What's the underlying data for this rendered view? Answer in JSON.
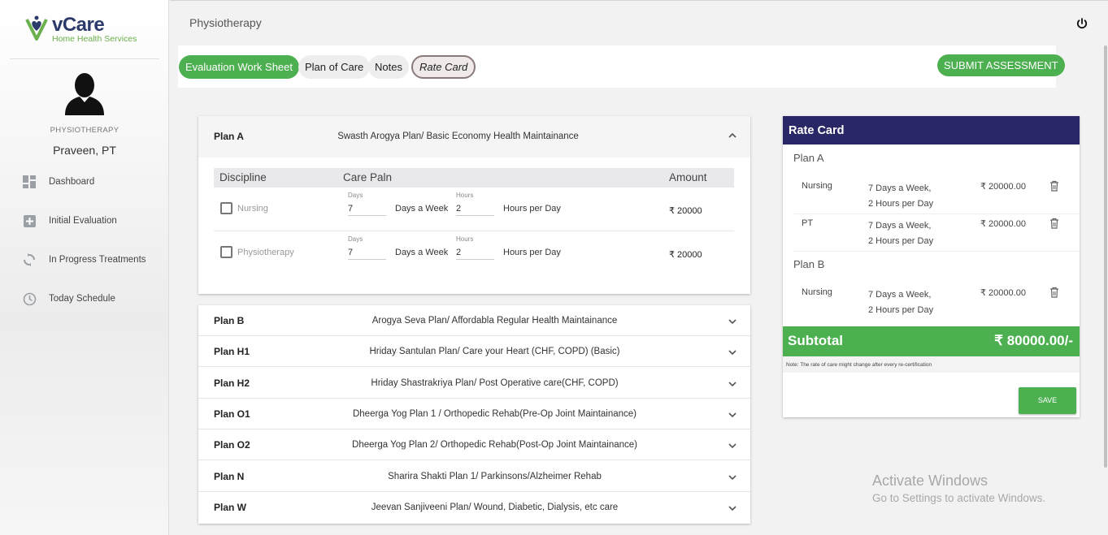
{
  "brand": {
    "name": "vCare",
    "tagline": "Home Health Services"
  },
  "user": {
    "role": "PHYSIOTHERAPY",
    "name": "Praveen, PT"
  },
  "nav": {
    "items": [
      {
        "label": "Dashboard",
        "icon": "dashboard-icon"
      },
      {
        "label": "Initial Evaluation",
        "icon": "plus-box-icon"
      },
      {
        "label": "In Progress Treatments",
        "icon": "sync-icon"
      },
      {
        "label": "Today Schedule",
        "icon": "clock-icon"
      }
    ]
  },
  "header": {
    "title": "Physiotherapy",
    "power_icon": "power-icon"
  },
  "tabs": [
    {
      "label": "Evaluation Work Sheet",
      "state": "active"
    },
    {
      "label": "Plan of Care",
      "state": "default"
    },
    {
      "label": "Notes",
      "state": "default"
    },
    {
      "label": "Rate Card",
      "state": "selected"
    }
  ],
  "submit_label": "SUBMIT ASSESSMENT",
  "planA": {
    "code": "Plan A",
    "desc": "Swasth Arogya Plan/ Basic Economy Health Maintainance",
    "columns": {
      "discipline": "Discipline",
      "care_plan": "Care Paln",
      "amount": "Amount"
    },
    "rows": [
      {
        "discipline": "Nursing",
        "days_label": "Days",
        "days": "7",
        "days_text": "Days a Week",
        "hours_label": "Hours",
        "hours": "2",
        "hours_text": "Hours per Day",
        "amount": "₹ 20000"
      },
      {
        "discipline": "Physiotherapy",
        "days_label": "Days",
        "days": "7",
        "days_text": "Days a Week",
        "hours_label": "Hours",
        "hours": "2",
        "hours_text": "Hours per Day",
        "amount": "₹ 20000"
      }
    ]
  },
  "plans": [
    {
      "code": "Plan B",
      "desc": "Arogya Seva Plan/ Affordabla Regular Health Maintainance"
    },
    {
      "code": "Plan H1",
      "desc": "Hriday Santulan Plan/ Care your Heart (CHF, COPD) (Basic)"
    },
    {
      "code": "Plan H2",
      "desc": "Hriday Shastrakriya Plan/ Post Operative care(CHF, COPD)"
    },
    {
      "code": "Plan O1",
      "desc": "Dheerga Yog Plan 1 / Orthopedic Rehab(Pre-Op Joint Maintainance)"
    },
    {
      "code": "Plan O2",
      "desc": "Dheerga Yog Plan 2/ Orthopedic Rehab(Post-Op Joint Maintainance)"
    },
    {
      "code": "Plan N",
      "desc": "Sharira Shakti Plan 1/ Parkinsons/Alzheimer Rehab"
    },
    {
      "code": "Plan W",
      "desc": "Jeevan Sanjiveeni Plan/ Wound, Diabetic, Dialysis, etc care"
    }
  ],
  "rate_card": {
    "title": "Rate Card",
    "groups": [
      {
        "plan": "Plan A",
        "items": [
          {
            "service": "Nursing",
            "sched1": "7 Days a Week,",
            "sched2": "2 Hours per Day",
            "price": "₹ 20000.00"
          },
          {
            "service": "PT",
            "sched1": "7 Days a Week,",
            "sched2": "2 Hours per Day",
            "price": "₹ 20000.00"
          }
        ]
      },
      {
        "plan": "Plan B",
        "items": [
          {
            "service": "Nursing",
            "sched1": "7 Days a Week,",
            "sched2": "2 Hours per Day",
            "price": "₹ 20000.00"
          }
        ]
      }
    ],
    "subtotal_label": "Subtotal",
    "subtotal_value": "₹ 80000.00/-",
    "note": "Note: The rate of care might change after every re-certification",
    "save_label": "SAVE"
  },
  "watermark": {
    "line1": "Activate Windows",
    "line2": "Go to Settings to activate Windows."
  },
  "colors": {
    "green": "#4caf50",
    "navy": "#2a2766",
    "brand_navy": "#2c3a6b",
    "brand_green": "#6ab04c"
  }
}
